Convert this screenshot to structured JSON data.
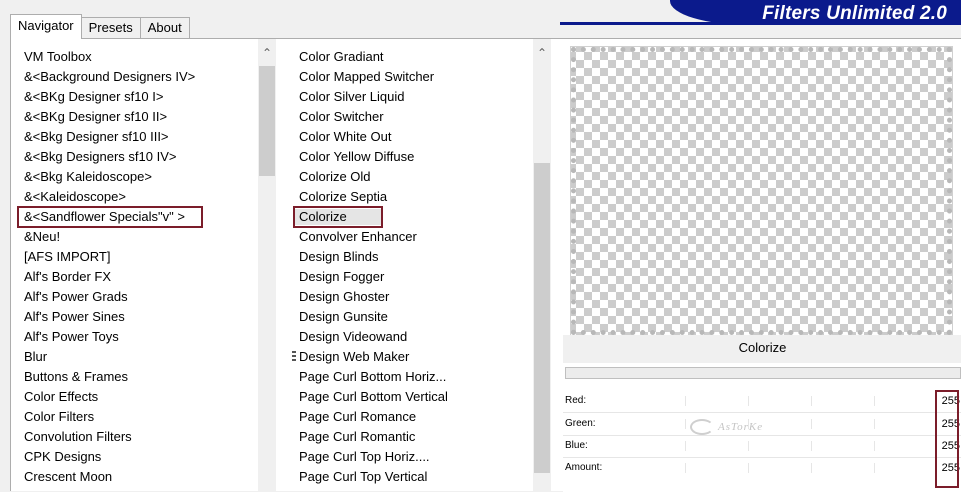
{
  "tabs": [
    {
      "label": "Navigator",
      "active": true
    },
    {
      "label": "Presets",
      "active": false
    },
    {
      "label": "About",
      "active": false
    }
  ],
  "brand": {
    "title": "Filters Unlimited 2.0",
    "color": "#0b1a8c"
  },
  "categories": {
    "selected_index": 8,
    "items": [
      " VM Toolbox",
      "&<Background Designers IV>",
      "&<BKg Designer sf10 I>",
      "&<BKg Designer sf10 II>",
      "&<Bkg Designer sf10 III>",
      "&<Bkg Designers sf10 IV>",
      "&<Bkg Kaleidoscope>",
      "&<Kaleidoscope>",
      "&<Sandflower Specials\"v\" >",
      "&Neu!",
      "[AFS IMPORT]",
      "Alf's Border FX",
      "Alf's Power Grads",
      "Alf's Power Sines",
      "Alf's Power Toys",
      "Blur",
      "Buttons & Frames",
      "Color Effects",
      "Color Filters",
      "Convolution Filters",
      "CPK Designs",
      "Crescent Moon"
    ]
  },
  "filters": {
    "selected_index": 8,
    "items": [
      "Color Gradiant",
      "Color Mapped Switcher",
      "Color Silver Liquid",
      "Color Switcher",
      "Color White Out",
      "Color Yellow Diffuse",
      "Colorize Old",
      "Colorize Septia",
      "Colorize",
      "Convolver Enhancer",
      "Design Blinds",
      "Design Fogger",
      "Design Ghoster",
      "Design Gunsite",
      "Design Videowand",
      "Design Web Maker",
      "Page Curl Bottom Horiz...",
      "Page Curl Bottom Vertical",
      "Page Curl Romance",
      "Page Curl Romantic",
      "Page Curl Top Horiz....",
      "Page Curl Top Vertical"
    ]
  },
  "preview": {
    "filter_name": "Colorize",
    "progress_fraction": 0.0
  },
  "params": [
    {
      "label": "Red:",
      "value": "255"
    },
    {
      "label": "Green:",
      "value": "255"
    },
    {
      "label": "Blue:",
      "value": "255"
    },
    {
      "label": "Amount:",
      "value": "255"
    }
  ],
  "watermark": "AsTorKe",
  "colors": {
    "highlight": "#7b1d2a",
    "progress": "#06b025"
  }
}
